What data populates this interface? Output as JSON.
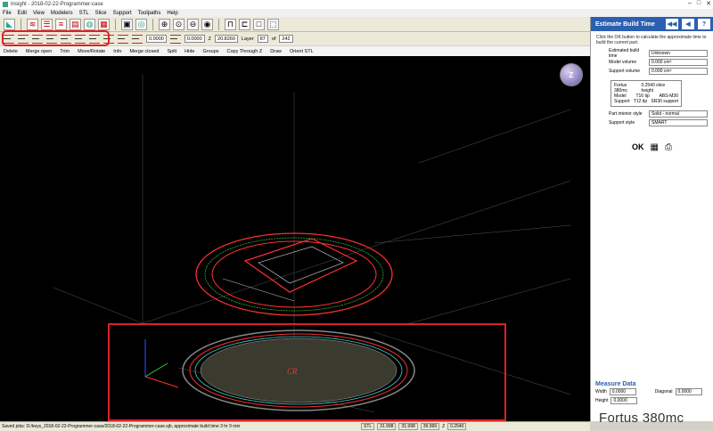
{
  "window": {
    "title": "Insight - 2018-02-22-Programmer-case",
    "controls": [
      "–",
      "□",
      "✕"
    ]
  },
  "menu": [
    "File",
    "Edit",
    "View",
    "Modelers",
    "STL",
    "Slice",
    "Support",
    "Toolpaths",
    "Help"
  ],
  "toolbar2": {
    "field1": "0.0000",
    "field2": "0.0000",
    "z_label": "Z",
    "z_value": "20.8260",
    "layer_label": "Layer",
    "layer_value": "87",
    "of_label": "of",
    "of_value": "242"
  },
  "edit_tools": [
    "Delete",
    "Merge open",
    "Trim",
    "Move/Rotate",
    "Info",
    "Merge closed",
    "Split",
    "Hide",
    "Groups",
    "Copy Through Z",
    "Draw",
    "Orient STL"
  ],
  "viewport": {
    "navcube_label": "Z"
  },
  "panel": {
    "title": "Estimate Build Time",
    "nav": [
      "◀◀",
      "◀",
      "?"
    ],
    "description": "Click the OK button to calculate the approximate time to build the current part.",
    "rows": [
      {
        "label": "Estimated build time",
        "value": "Unknown"
      },
      {
        "label": "Model volume",
        "value": "0.000 cm³"
      },
      {
        "label": "Support volume",
        "value": "0.000 cm³"
      }
    ],
    "machine": {
      "name": "Fortus 380mc",
      "slice": "0.2540 slice height",
      "model_label": "Model",
      "model_tip": "T16 tip",
      "model_mat": "ABS-M30",
      "support_label": "Support",
      "support_tip": "T12 tip",
      "support_mat": "SR30 support"
    },
    "styles": [
      {
        "label": "Part interior style",
        "value": "Solid - normal"
      },
      {
        "label": "Support style",
        "value": "SMART"
      }
    ],
    "ok_label": "OK"
  },
  "measure": {
    "title": "Measure Data",
    "width_label": "Width",
    "width_value": "0.0000",
    "diagonal_label": "Diagonal",
    "diagonal_value": "0.0000",
    "height_label": "Height",
    "height_value": "0.0000"
  },
  "brand": "Fortus 380mc",
  "status": {
    "saved": "Saved jobs: D:/keys_2018-02-22-Programmer-case/2018-02-22-Programmer-case.sjb, approximate build time 3 hr 9 min",
    "mode": "STL",
    "x": "31.998",
    "y": "31.998",
    "zv": "39.999",
    "z_label": "Z",
    "zval": "0.2540"
  },
  "colors": {
    "panel_header": "#2b5fb0",
    "highlight": "#e02020",
    "toolpath_red": "#ff3030",
    "toolpath_green": "#30d040"
  }
}
